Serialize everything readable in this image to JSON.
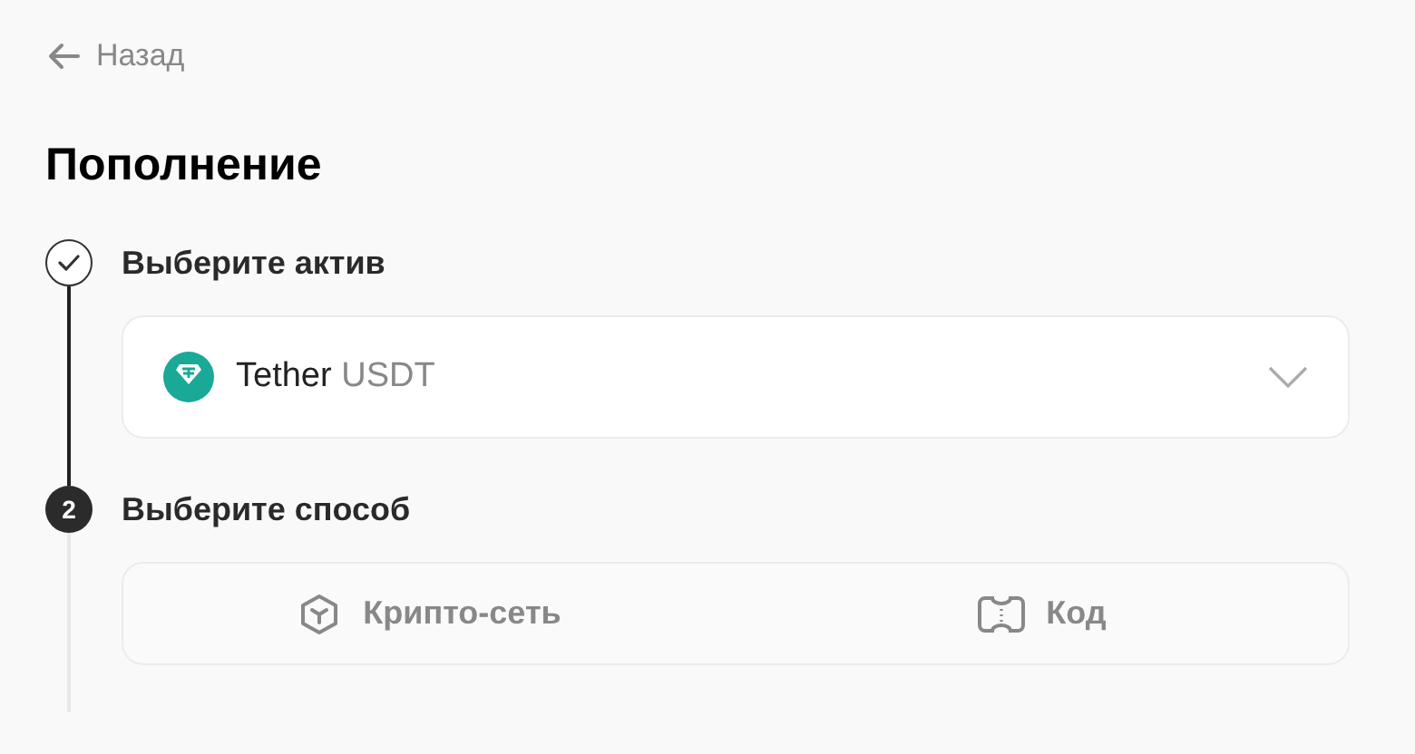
{
  "back": {
    "label": "Назад"
  },
  "title": "Пополнение",
  "steps": [
    {
      "done": true,
      "title": "Выберите актив",
      "kind": "select",
      "asset": {
        "name": "Tether",
        "ticker": "USDT"
      }
    },
    {
      "done": false,
      "number": "2",
      "title": "Выберите способ",
      "kind": "options",
      "options": [
        {
          "label": "Крипто-сеть",
          "kind": "network",
          "selected": false
        },
        {
          "label": "Код",
          "kind": "code",
          "selected": false
        }
      ]
    }
  ]
}
